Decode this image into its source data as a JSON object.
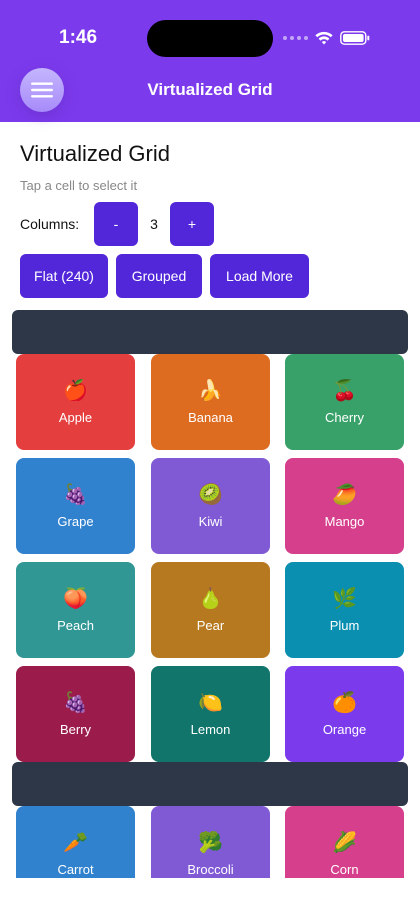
{
  "status_bar": {
    "time": "1:46"
  },
  "header": {
    "title": "Virtualized Grid"
  },
  "page": {
    "title": "Virtualized Grid",
    "subtitle": "Tap a cell to select it"
  },
  "columns": {
    "label": "Columns:",
    "decrement": "-",
    "value": "3",
    "increment": "+"
  },
  "modes": {
    "flat": "Flat (240)",
    "grouped": "Grouped",
    "load_more": "Load More"
  },
  "colors": {
    "appbar": "#7c3aed",
    "button": "#5227d9",
    "section_header": "#2d3748"
  },
  "cells": [
    {
      "emoji": "🍎",
      "label": "Apple",
      "color": "#e53e3e"
    },
    {
      "emoji": "🍌",
      "label": "Banana",
      "color": "#dd6b20"
    },
    {
      "emoji": "🍒",
      "label": "Cherry",
      "color": "#38a169"
    },
    {
      "emoji": "🍇",
      "label": "Grape",
      "color": "#3182ce"
    },
    {
      "emoji": "🥝",
      "label": "Kiwi",
      "color": "#805ad5"
    },
    {
      "emoji": "🥭",
      "label": "Mango",
      "color": "#d53f8c"
    },
    {
      "emoji": "🍑",
      "label": "Peach",
      "color": "#319795"
    },
    {
      "emoji": "🍐",
      "label": "Pear",
      "color": "#b7791f"
    },
    {
      "emoji": "🌿",
      "label": "Plum",
      "color": "#0b8fb0"
    },
    {
      "emoji": "🍇",
      "label": "Berry",
      "color": "#9b1c4a"
    },
    {
      "emoji": "🍋",
      "label": "Lemon",
      "color": "#11756b"
    },
    {
      "emoji": "🍊",
      "label": "Orange",
      "color": "#7c3aed"
    },
    {
      "emoji": "🥕",
      "label": "Carrot",
      "color": "#3182ce"
    },
    {
      "emoji": "🥦",
      "label": "Broccoli",
      "color": "#805ad5"
    },
    {
      "emoji": "🌽",
      "label": "Corn",
      "color": "#d53f8c"
    }
  ]
}
